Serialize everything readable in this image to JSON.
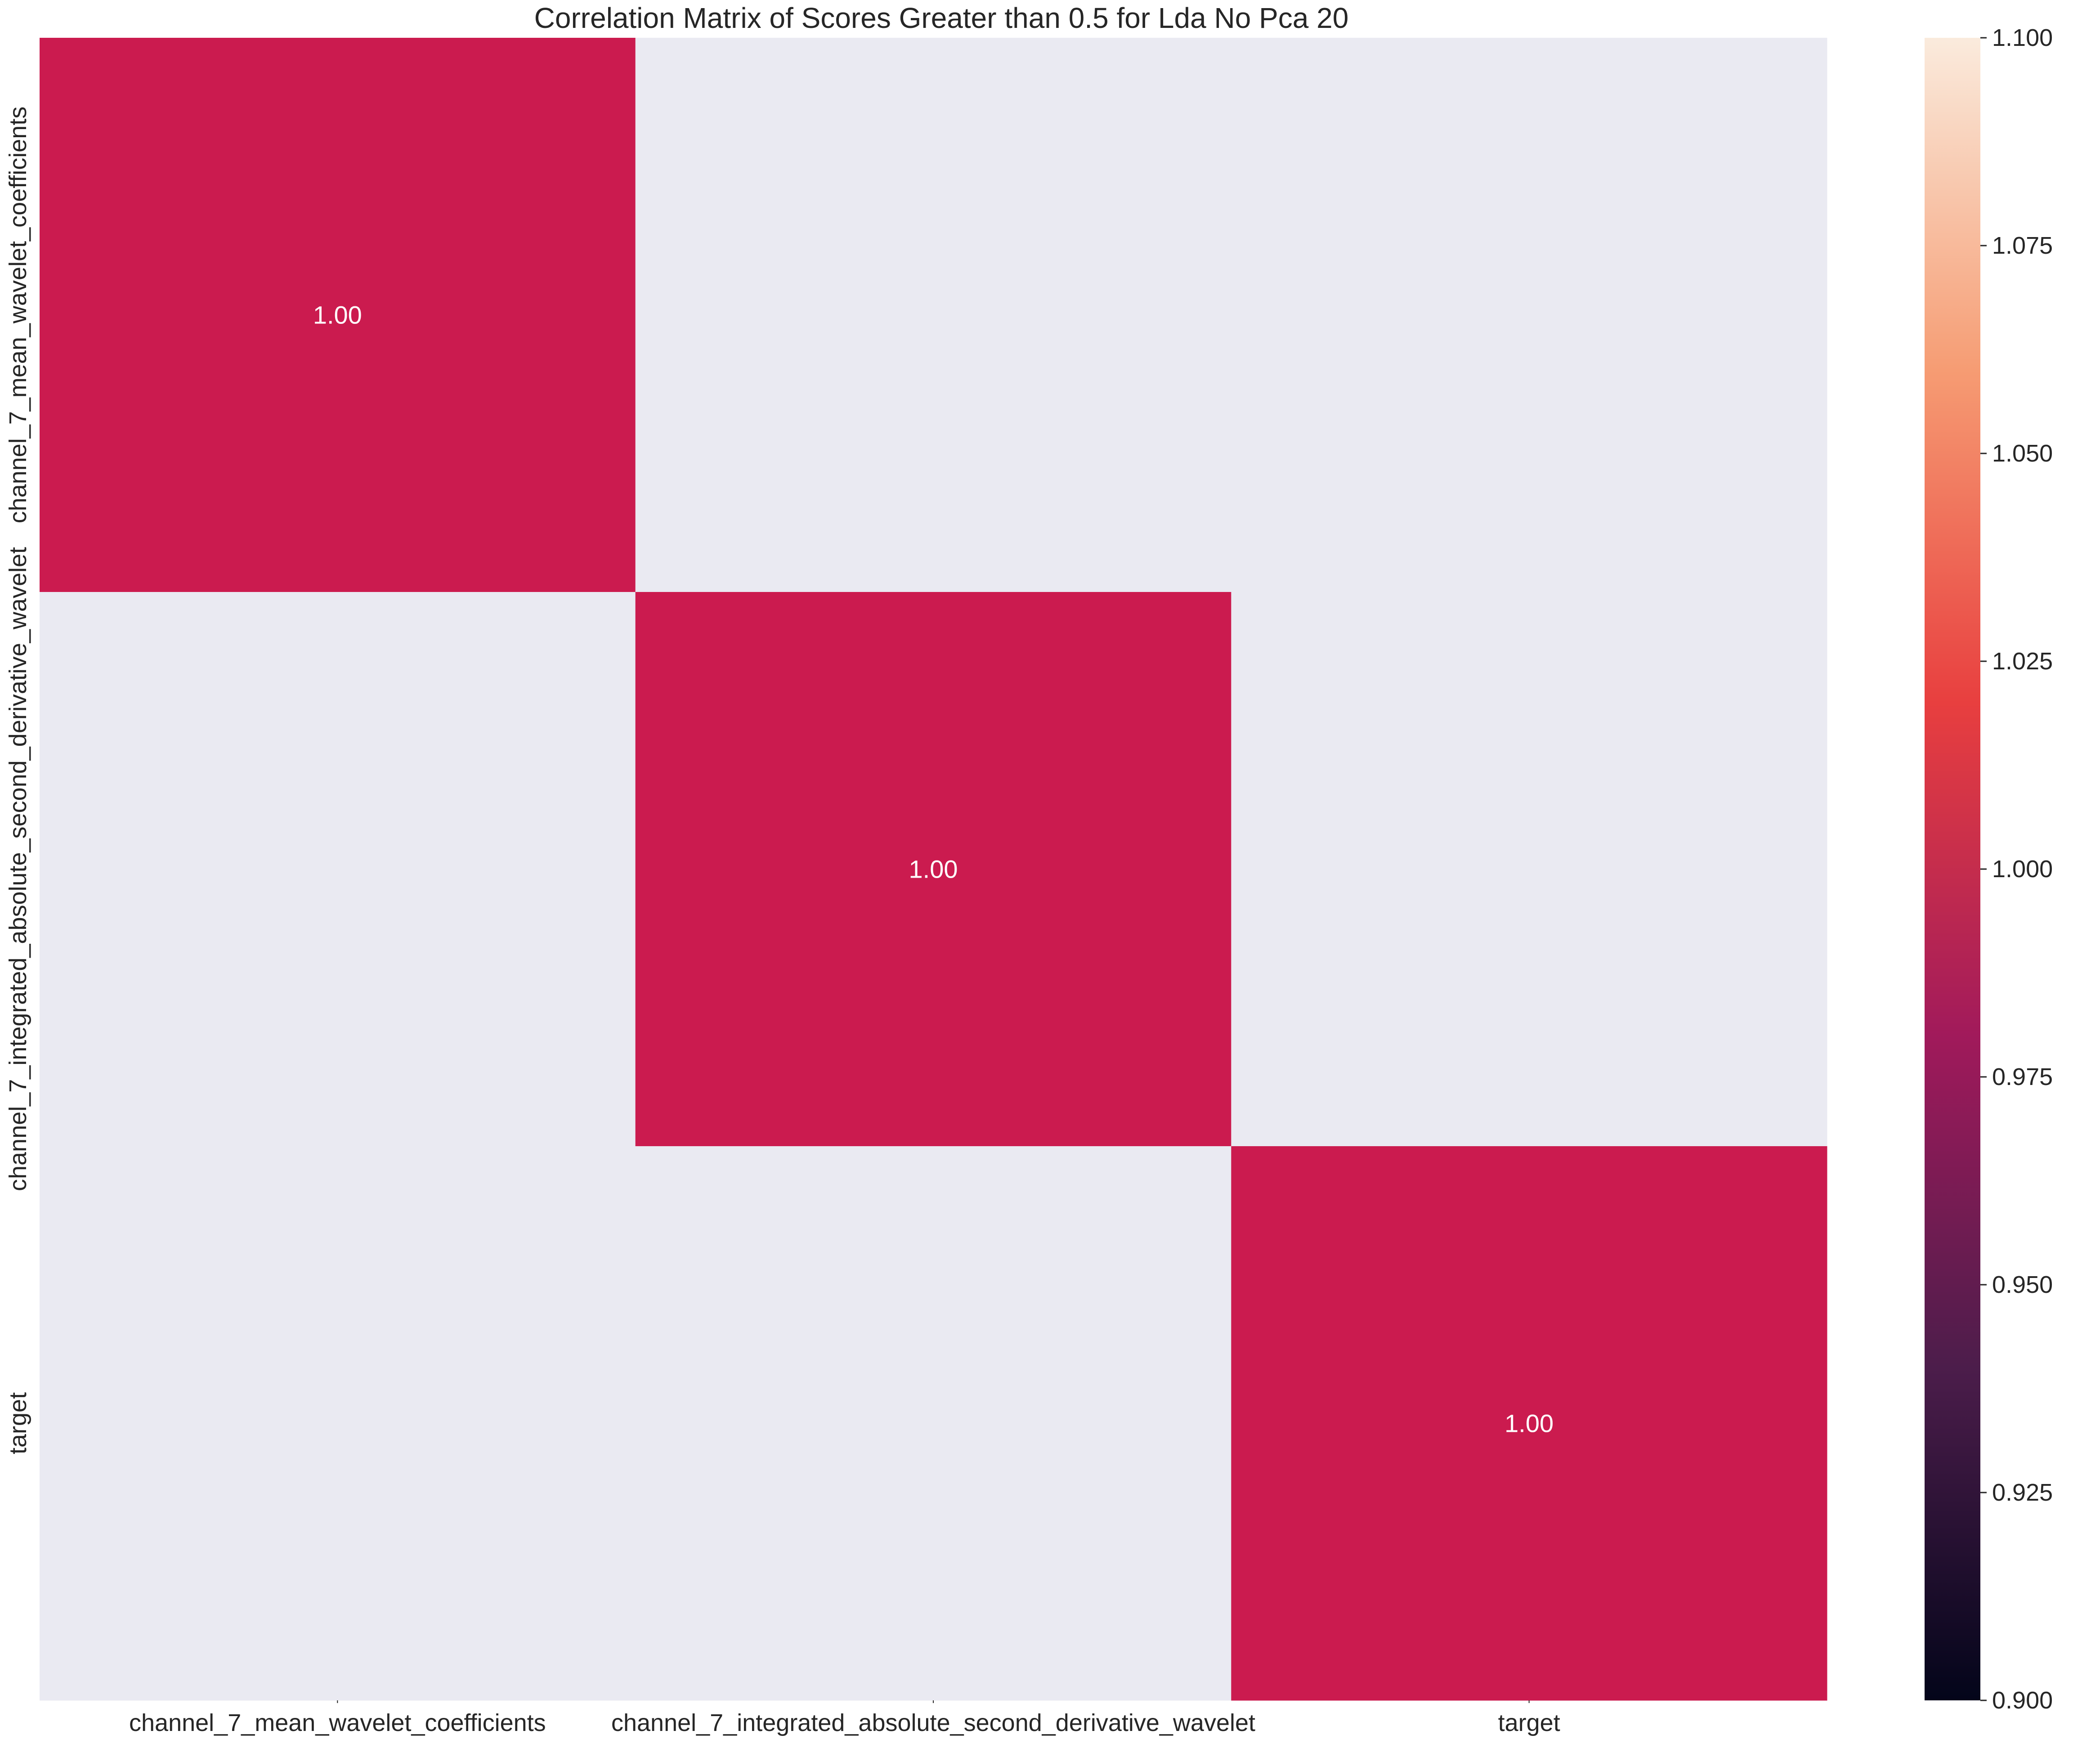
{
  "chart_data": {
    "type": "heatmap",
    "title": "Correlation Matrix of Scores Greater than 0.5 for Lda No Pca 20",
    "xlabel": "",
    "ylabel": "",
    "x_categories": [
      "channel_7_mean_wavelet_coefficients",
      "channel_7_integrated_absolute_second_derivative_wavelet",
      "target"
    ],
    "y_categories": [
      "channel_7_mean_wavelet_coefficients",
      "channel_7_integrated_absolute_second_derivative_wavelet",
      "target"
    ],
    "values": [
      [
        1.0,
        null,
        null
      ],
      [
        null,
        1.0,
        null
      ],
      [
        null,
        null,
        1.0
      ]
    ],
    "cell_labels": [
      [
        "1.00",
        "",
        ""
      ],
      [
        "",
        "1.00",
        ""
      ],
      [
        "",
        "",
        "1.00"
      ]
    ],
    "masked_color": "#eaeaf2",
    "cell_color": "#cb1b4f",
    "annotation_color": "#ffffff",
    "colorbar": {
      "vmin": 0.9,
      "vmax": 1.1,
      "ticks": [
        "0.900",
        "0.925",
        "0.950",
        "0.975",
        "1.000",
        "1.025",
        "1.050",
        "1.075",
        "1.100"
      ],
      "colormap": "rocket",
      "colors": [
        "#03051a",
        "#4c1d4b",
        "#a11a5b",
        "#e83f3f",
        "#f69c73",
        "#faebdd"
      ]
    },
    "grid": false,
    "legend": "colorbar-right"
  }
}
